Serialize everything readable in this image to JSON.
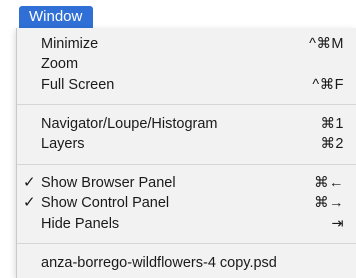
{
  "menubar": {
    "title": "Window"
  },
  "menu": {
    "items": [
      {
        "label": "Minimize",
        "shortcut": "^⌘M",
        "checked": false
      },
      {
        "label": "Zoom",
        "shortcut": "",
        "checked": false
      },
      {
        "label": "Full Screen",
        "shortcut": "^⌘F",
        "checked": false
      },
      {
        "label": "Navigator/Loupe/Histogram",
        "shortcut": "⌘1",
        "checked": false
      },
      {
        "label": "Layers",
        "shortcut": "⌘2",
        "checked": false
      },
      {
        "label": "Show Browser Panel",
        "shortcut": "⌘←",
        "checked": true,
        "check_mark": "✓"
      },
      {
        "label": "Show Control Panel",
        "shortcut": "⌘→",
        "checked": true,
        "check_mark": "✓"
      },
      {
        "label": "Hide Panels",
        "shortcut": "⇥",
        "checked": false
      },
      {
        "label": "anza-borrego-wildflowers-4 copy.psd",
        "shortcut": "",
        "checked": false
      }
    ]
  },
  "colors": {
    "menu_title_bg": "#2f6fd6",
    "menu_panel_bg": "#f2f2f2",
    "separator": "#d6d6d6"
  }
}
